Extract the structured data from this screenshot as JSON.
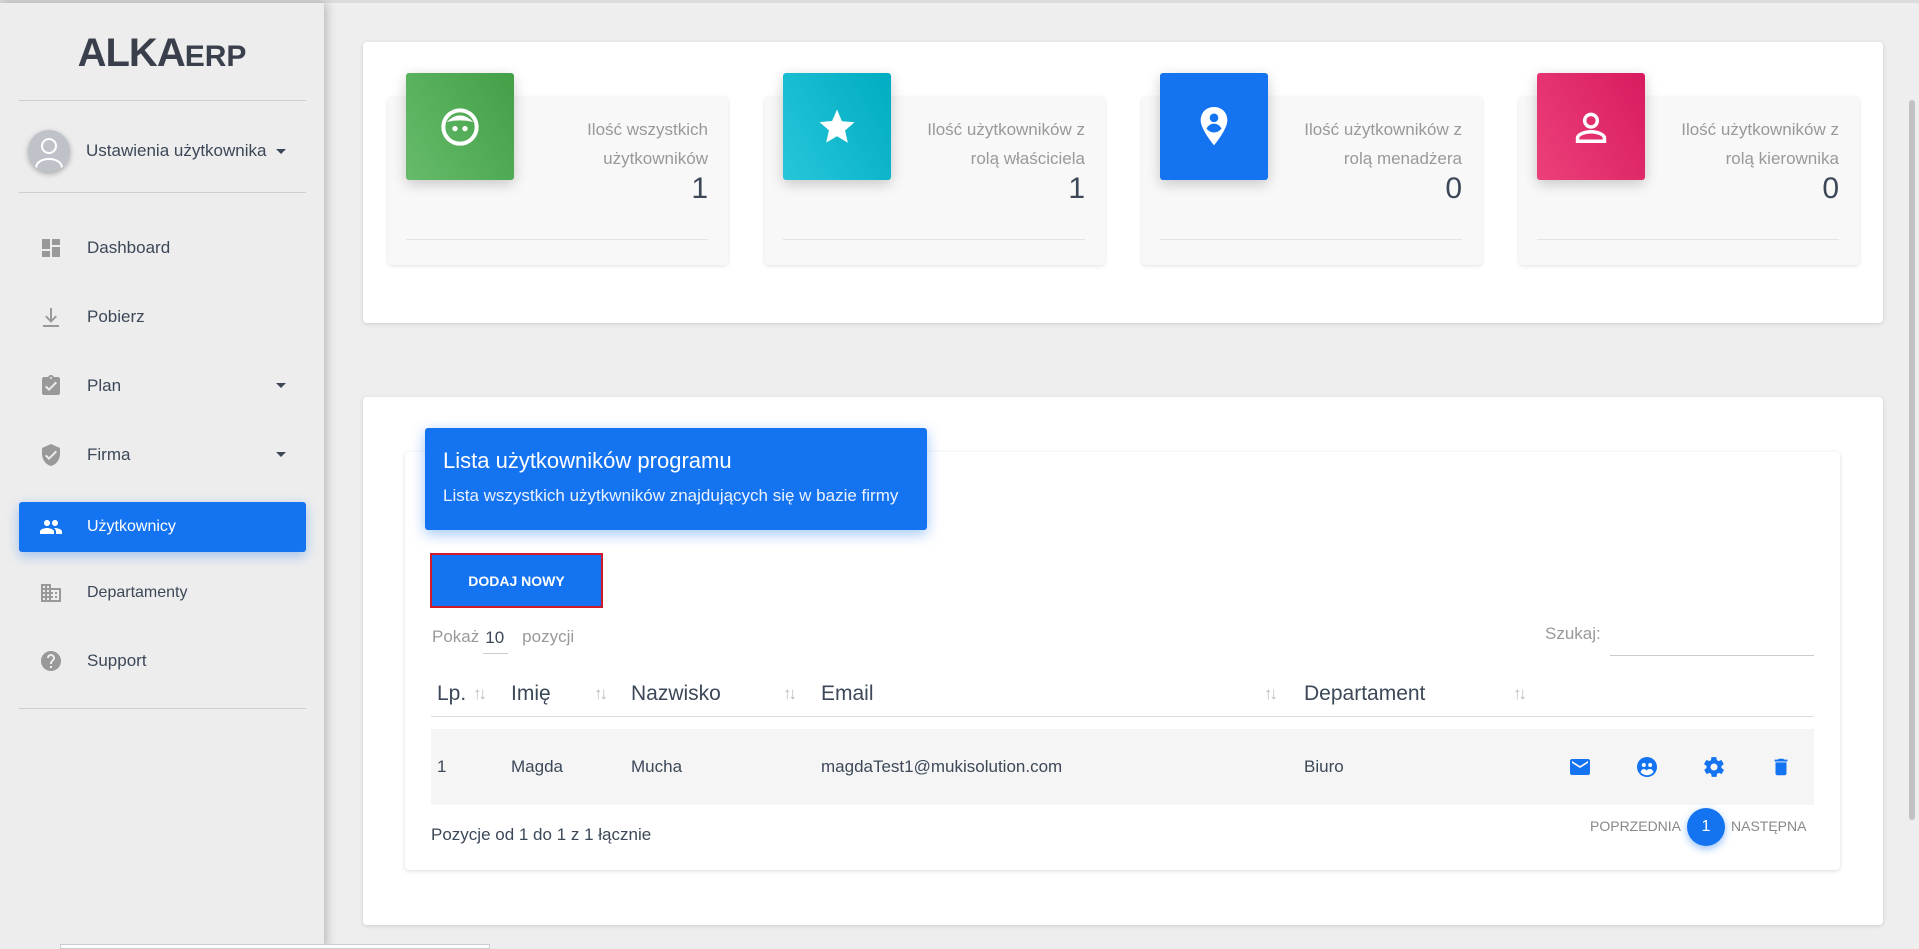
{
  "app": {
    "logo_main": "ALKA",
    "logo_sub": "ERP"
  },
  "user_menu": {
    "label": "Ustawienia użytkownika"
  },
  "sidebar": {
    "items": [
      {
        "label": "Dashboard",
        "icon": "dashboard-icon"
      },
      {
        "label": "Pobierz",
        "icon": "download-icon"
      },
      {
        "label": "Plan",
        "icon": "clipboard-check-icon"
      },
      {
        "label": "Firma",
        "icon": "shield-check-icon"
      },
      {
        "label": "Użytkownicy",
        "icon": "users-icon"
      },
      {
        "label": "Departamenty",
        "icon": "building-icon"
      },
      {
        "label": "Support",
        "icon": "help-icon"
      }
    ]
  },
  "stats": [
    {
      "label": "Ilość wszystkich użytkowników",
      "value": "1",
      "color": "#4caf50",
      "icon": "face-icon"
    },
    {
      "label": "Ilość użytkowników z rolą właściciela",
      "value": "1",
      "color": "#1cb5cc",
      "icon": "star-icon"
    },
    {
      "label": "Ilość użytkowników z rolą menadżera",
      "value": "0",
      "color": "#1473f0",
      "icon": "location-person-icon"
    },
    {
      "label": "Ilość użytkowników z rolą kierownika",
      "value": "0",
      "color": "#e8336c",
      "icon": "person-icon"
    }
  ],
  "users_panel": {
    "title": "Lista użytkowników programu",
    "subtitle": "Lista wszystkich użytkwników znajdujących się w bazie firmy",
    "add_button": "DODAJ NOWY",
    "show_prefix": "Pokaż",
    "show_value": "10",
    "show_suffix": "pozycji",
    "search_label": "Szukaj:",
    "search_value": "",
    "columns": [
      "Lp.",
      "Imię",
      "Nazwisko",
      "Email",
      "Departament"
    ],
    "rows": [
      {
        "lp": "1",
        "imie": "Magda",
        "nazwisko": "Mucha",
        "email": "magdaTest1@mukisolution.com",
        "departament": "Biuro"
      }
    ],
    "info": "Pozycje od 1 do 1 z 1 łącznie",
    "prev": "POPRZEDNIA",
    "page": "1",
    "next": "NASTĘPNA"
  },
  "colors": {
    "accent": "#1473f0",
    "highlight_border": "#d11a2a"
  }
}
